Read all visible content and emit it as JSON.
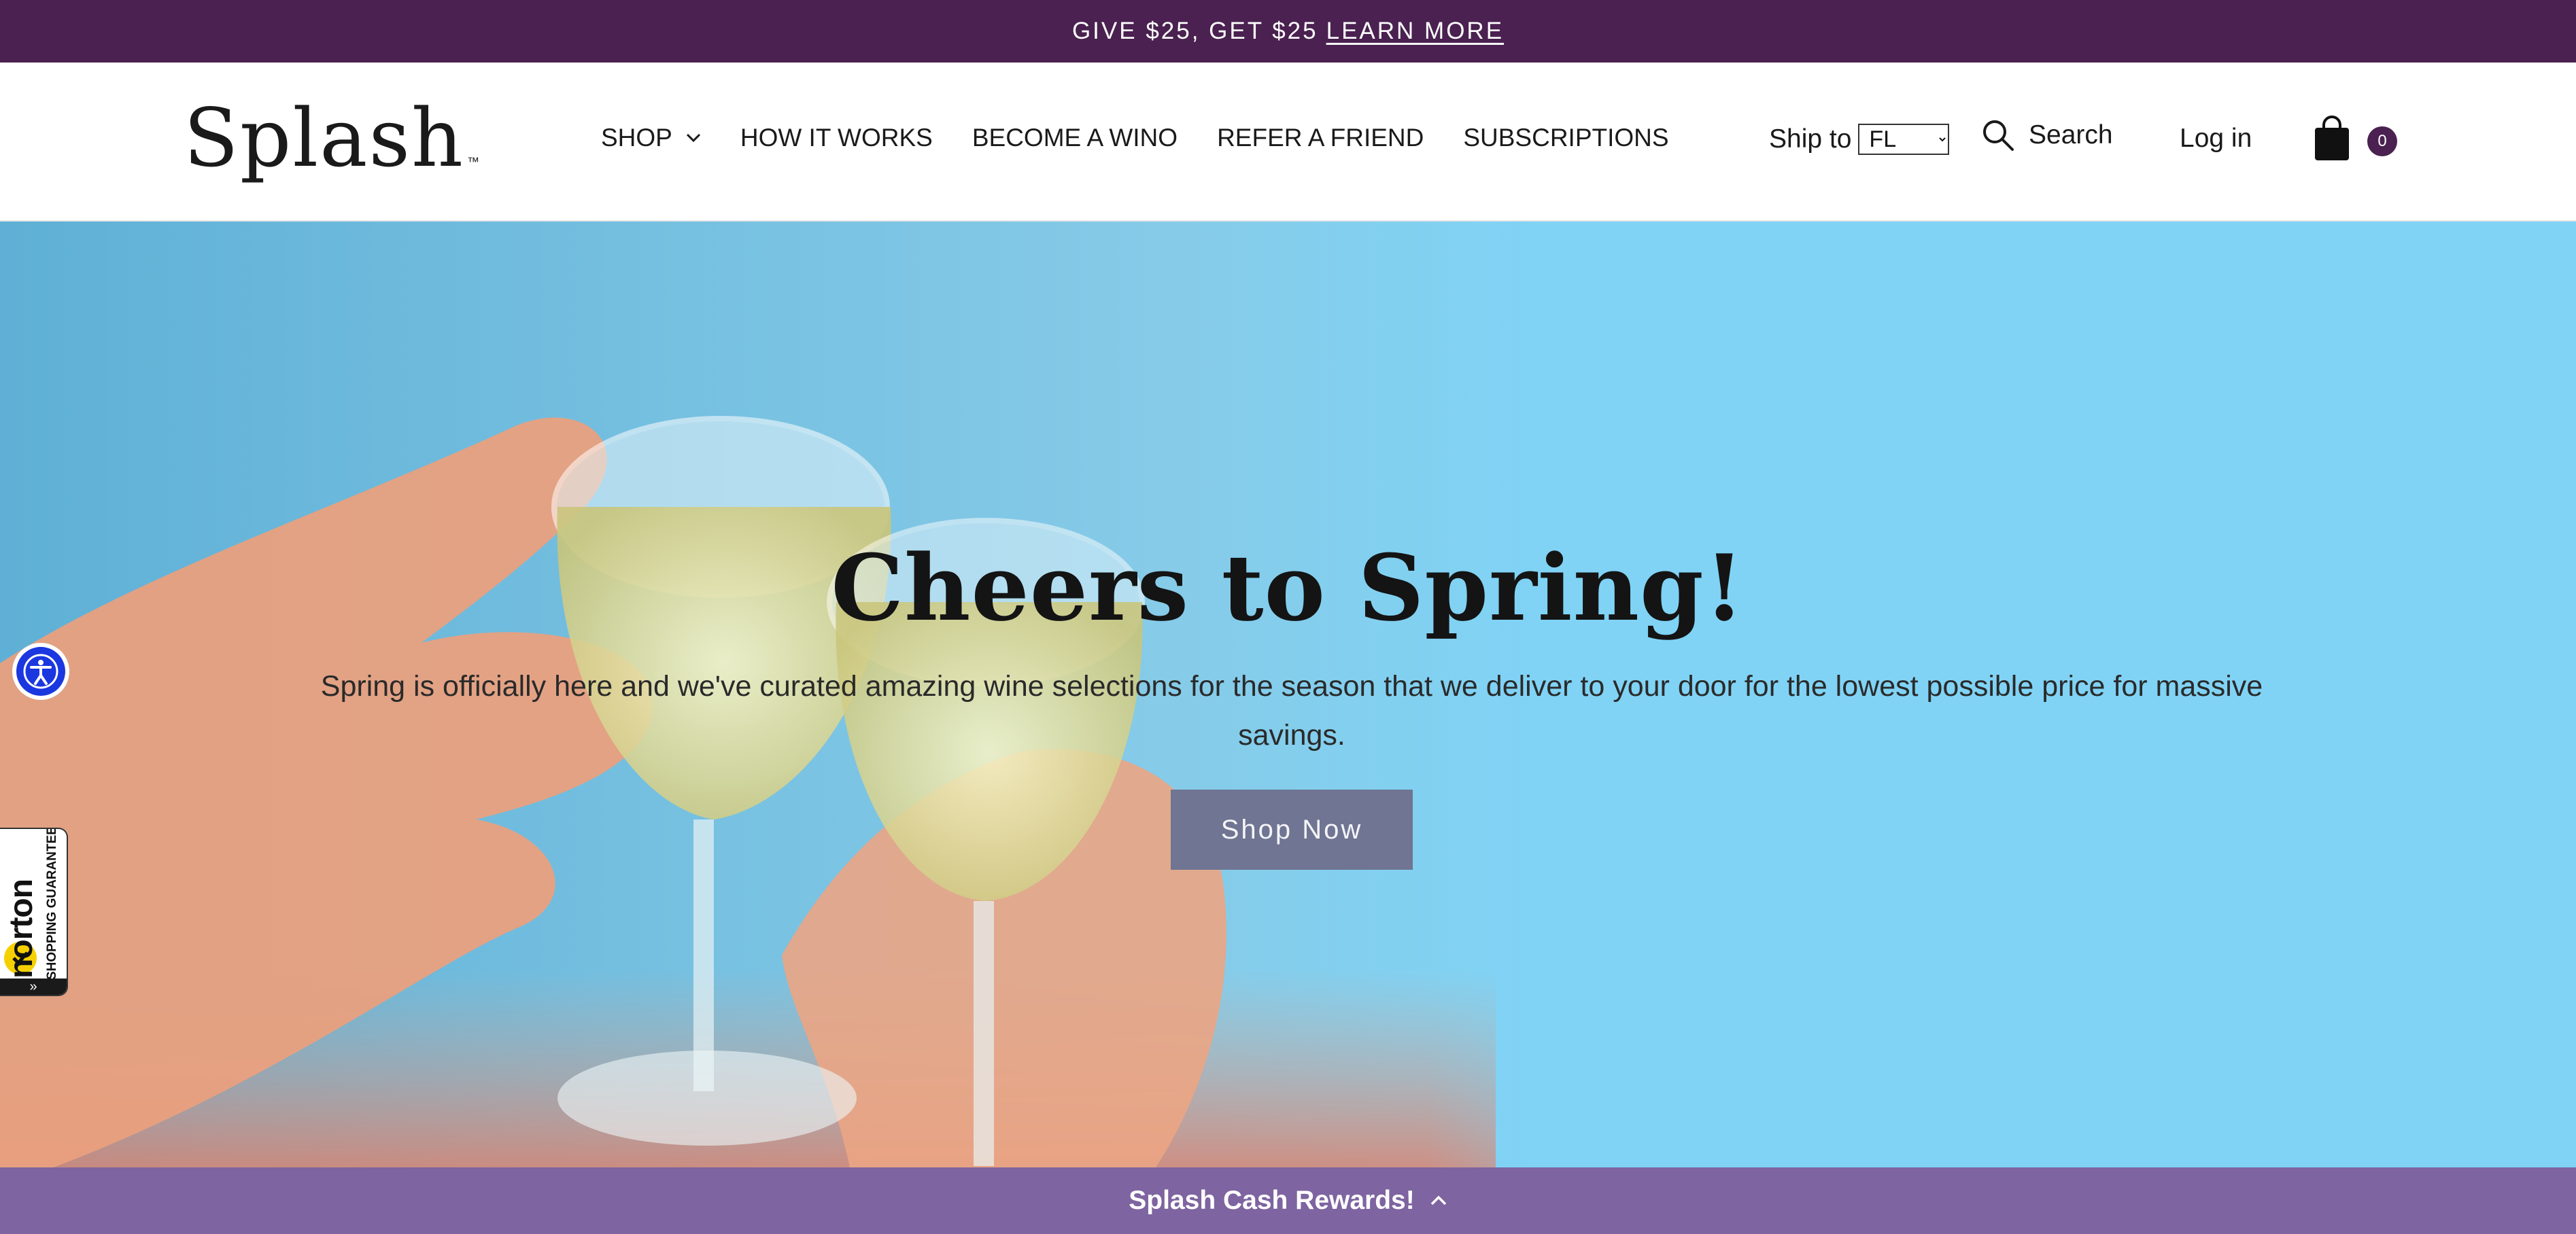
{
  "announcement": {
    "text": "GIVE $25, GET $25",
    "link_label": "LEARN MORE"
  },
  "header": {
    "logo": "Splash",
    "logo_mark": "™",
    "nav": [
      {
        "label": "SHOP",
        "icon": "chevron-down-icon"
      },
      {
        "label": "HOW IT WORKS"
      },
      {
        "label": "BECOME A WINO"
      },
      {
        "label": "REFER A FRIEND"
      },
      {
        "label": "SUBSCRIPTIONS"
      }
    ],
    "ship_to_label": "Ship to",
    "ship_to_value": "FL",
    "search_label": "Search",
    "login_label": "Log in",
    "cart_count": "0"
  },
  "hero": {
    "title": "Cheers to Spring!",
    "subtitle": "Spring is officially here and we've curated amazing wine selections for the season that we deliver to your door for the lowest possible price for massive savings.",
    "cta_label": "Shop Now"
  },
  "norton": {
    "brand": "norton",
    "tagline": "SHOPPING GUARANTEE",
    "expand_glyph": "»"
  },
  "rewards": {
    "label": "Splash Cash Rewards!"
  },
  "colors": {
    "announcement_bg": "#4a2150",
    "hero_sky": "#80d3f5",
    "cta_bg": "#6f7592",
    "rewards_bg": "#7e64a0",
    "accessibility_blue": "#1a37e0"
  }
}
